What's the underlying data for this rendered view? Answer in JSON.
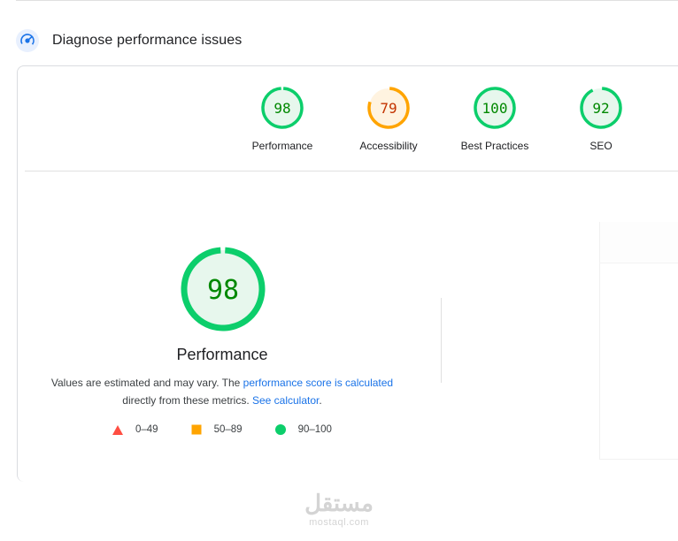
{
  "section": {
    "title": "Diagnose performance issues",
    "icon": "speedometer-icon"
  },
  "gauges": [
    {
      "label": "Performance",
      "score": "98",
      "value": 98,
      "color": "#0cce6b",
      "text_color": "#008800",
      "fill": "#e7f7ed"
    },
    {
      "label": "Accessibility",
      "score": "79",
      "value": 79,
      "color": "#ffa400",
      "text_color": "#c33300",
      "fill": "#fff3e0"
    },
    {
      "label": "Best Practices",
      "score": "100",
      "value": 100,
      "color": "#0cce6b",
      "text_color": "#008800",
      "fill": "#e7f7ed"
    },
    {
      "label": "SEO",
      "score": "92",
      "value": 92,
      "color": "#0cce6b",
      "text_color": "#008800",
      "fill": "#e7f7ed"
    }
  ],
  "main": {
    "score": "98",
    "value": 98,
    "title": "Performance",
    "desc_prefix": "Values are estimated and may vary. The ",
    "desc_link": "performance score is calculated",
    "desc_middle": "directly from these metrics. ",
    "desc_link2": "See calculator",
    "desc_suffix": "."
  },
  "legend": [
    {
      "range": "0–49",
      "shape": "triangle",
      "color": "#ff4e42"
    },
    {
      "range": "50–89",
      "shape": "square",
      "color": "#ffa400"
    },
    {
      "range": "90–100",
      "shape": "circle",
      "color": "#0cce6b"
    }
  ],
  "watermark": {
    "arabic": "مستقل",
    "latin": "mostaql.com"
  }
}
